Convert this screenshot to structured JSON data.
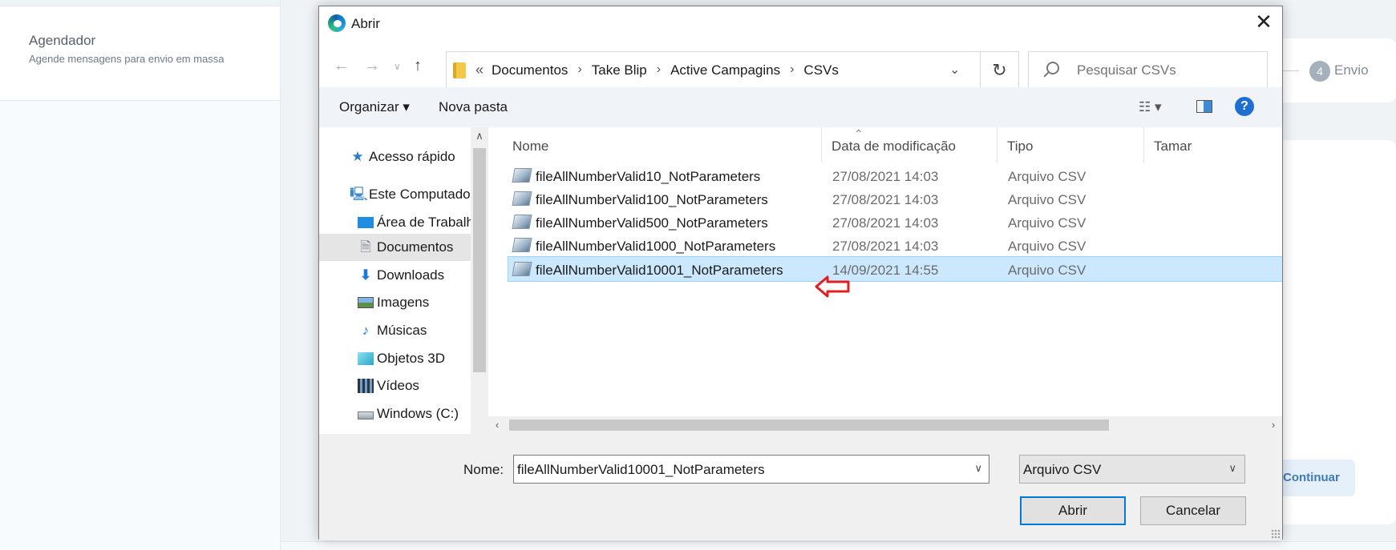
{
  "background": {
    "sidebar_title": "Agendador",
    "sidebar_desc": "Agende mensagens para envio em massa",
    "step_number": "4",
    "step_label": "Envio",
    "continue_label": "Continuar"
  },
  "dialog": {
    "title": "Abrir",
    "close_glyph": "✕",
    "breadcrumb": [
      "Documentos",
      "Take Blip",
      "Active Campagins",
      "CSVs"
    ],
    "search_placeholder": "Pesquisar CSVs",
    "toolbar": {
      "organize": "Organizar ▾",
      "new_folder": "Nova pasta",
      "help": "?"
    },
    "nav_tree": [
      {
        "label": "Acesso rápido",
        "icon": "star-icon"
      },
      {
        "label": "Este Computador",
        "icon": "computer-icon"
      },
      {
        "label": "Área de Trabalho",
        "icon": "desktop-icon"
      },
      {
        "label": "Documentos",
        "icon": "documents-icon",
        "selected": true
      },
      {
        "label": "Downloads",
        "icon": "downloads-icon"
      },
      {
        "label": "Imagens",
        "icon": "pictures-icon"
      },
      {
        "label": "Músicas",
        "icon": "music-icon"
      },
      {
        "label": "Objetos 3D",
        "icon": "3d-objects-icon"
      },
      {
        "label": "Vídeos",
        "icon": "videos-icon"
      },
      {
        "label": "Windows (C:)",
        "icon": "drive-icon"
      }
    ],
    "columns": [
      "Nome",
      "Data de modificação",
      "Tipo",
      "Tamar"
    ],
    "files": [
      {
        "name": "fileAllNumberValid10_NotParameters",
        "date": "27/08/2021 14:03",
        "type": "Arquivo CSV"
      },
      {
        "name": "fileAllNumberValid100_NotParameters",
        "date": "27/08/2021 14:03",
        "type": "Arquivo CSV"
      },
      {
        "name": "fileAllNumberValid500_NotParameters",
        "date": "27/08/2021 14:03",
        "type": "Arquivo CSV"
      },
      {
        "name": "fileAllNumberValid1000_NotParameters",
        "date": "27/08/2021 14:03",
        "type": "Arquivo CSV"
      },
      {
        "name": "fileAllNumberValid10001_NotParameters",
        "date": "14/09/2021 14:55",
        "type": "Arquivo CSV",
        "selected": true
      }
    ],
    "filename_label": "Nome:",
    "filename_value": "fileAllNumberValid10001_NotParameters",
    "filetype_value": "Arquivo CSV",
    "open_label": "Abrir",
    "cancel_label": "Cancelar",
    "colors": {
      "selection": "#cce8ff",
      "arrow": "#e02020",
      "accent": "#0078d7"
    }
  }
}
